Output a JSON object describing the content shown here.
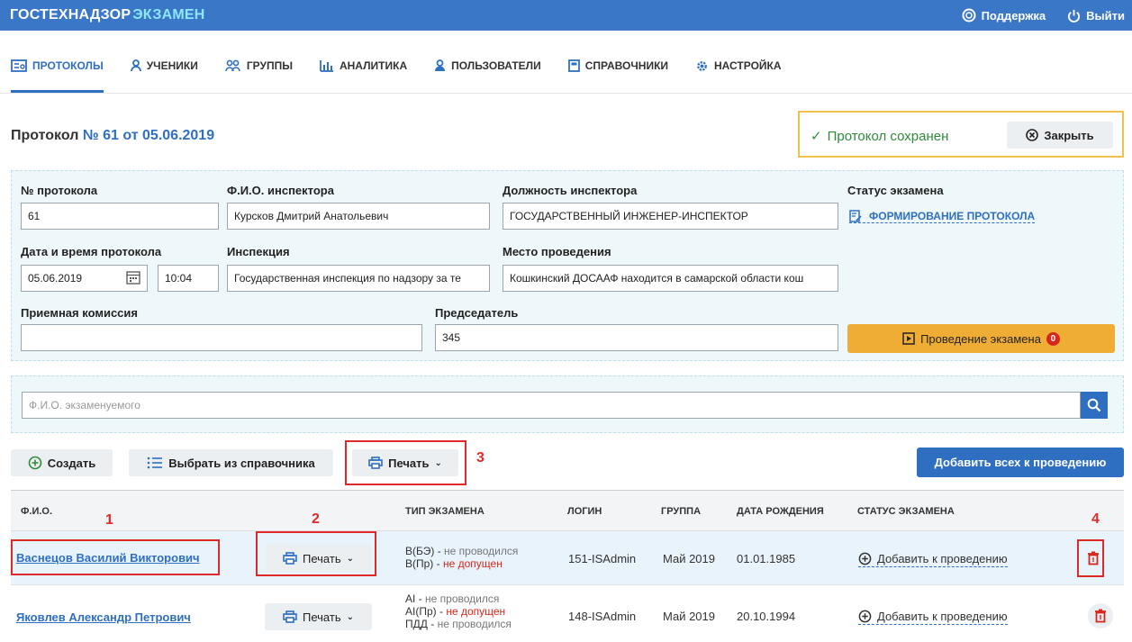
{
  "app": {
    "brand_main": "ГОСТЕХНАДЗОР",
    "brand_accent": "ЭКЗАМЕН",
    "support": "Поддержка",
    "logout": "Выйти"
  },
  "nav": [
    {
      "label": "ПРОТОКОЛЫ",
      "icon": "protocol-icon",
      "active": true
    },
    {
      "label": "УЧЕНИКИ",
      "icon": "student-icon"
    },
    {
      "label": "ГРУППЫ",
      "icon": "group-icon"
    },
    {
      "label": "АНАЛИТИКА",
      "icon": "analytics-icon"
    },
    {
      "label": "ПОЛЬЗОВАТЕЛИ",
      "icon": "users-icon"
    },
    {
      "label": "СПРАВОЧНИКИ",
      "icon": "reference-icon"
    },
    {
      "label": "НАСТРОЙКА",
      "icon": "settings-icon"
    }
  ],
  "header": {
    "title_prefix": "Протокол",
    "title_number": "№ 61 от 05.06.2019",
    "saved_text": "Протокол сохранен",
    "close_label": "Закрыть"
  },
  "form": {
    "protocol_no_label": "№ протокола",
    "protocol_no": "61",
    "inspector_label": "Ф.И.О. инспектора",
    "inspector": "Курсков Дмитрий Анатольевич",
    "position_label": "Должность инспектора",
    "position": "ГОСУДАРСТВЕННЫЙ ИНЖЕНЕР-ИНСПЕКТОР",
    "status_label": "Статус экзамена",
    "status_value": "ФОРМИРОВАНИЕ ПРОТОКОЛА",
    "datetime_label": "Дата и время протокола",
    "date": "05.06.2019",
    "time": "10:04",
    "inspection_label": "Инспекция",
    "inspection": "Государственная инспекция по надзору за те",
    "place_label": "Место проведения",
    "place": "Кошкинский ДОСААФ находится в самарской области кош",
    "commission_label": "Приемная комиссия",
    "commission": "",
    "chairman_label": "Председатель",
    "chairman": "345",
    "exam_button": "Проведение экзамена",
    "exam_badge": "0"
  },
  "search": {
    "placeholder": "Ф.И.О. экзаменуемого"
  },
  "toolbar": {
    "create": "Создать",
    "choose": "Выбрать из справочника",
    "print": "Печать",
    "add_all": "Добавить всех к проведению"
  },
  "annotations": {
    "n1": "1",
    "n2": "2",
    "n3": "3",
    "n4": "4"
  },
  "table": {
    "columns": [
      "Ф.И.О.",
      "ТИП ЭКЗАМЕНА",
      "ЛОГИН",
      "ГРУППА",
      "ДАТА РОЖДЕНИЯ",
      "СТАТУС ЭКЗАМЕНА"
    ],
    "rows": [
      {
        "name": "Васнецов Василий Викторович",
        "print": "Печать",
        "exam1_type": "В(БЭ)",
        "exam1_sep": " - ",
        "exam1_status": "не проводился",
        "exam2_type": "В(Пр)",
        "exam2_sep": " - ",
        "exam2_status": "не допущен",
        "login": "151-ISAdmin",
        "group": "Май 2019",
        "birth": "01.01.1985",
        "action": "Добавить к проведению"
      },
      {
        "name": "Яковлев Александр Петрович",
        "print": "Печать",
        "exam1_type": "AI",
        "exam1_sep": " - ",
        "exam1_status": "не проводился",
        "exam2_type": "AI(Пр)",
        "exam2_sep": " - ",
        "exam2_status": "не допущен",
        "exam3_type": "ПДД",
        "exam3_sep": " - ",
        "exam3_status": "не проводился",
        "login": "148-ISAdmin",
        "group": "Май 2019",
        "birth": "20.10.1994",
        "action": "Добавить к проведению"
      }
    ]
  }
}
